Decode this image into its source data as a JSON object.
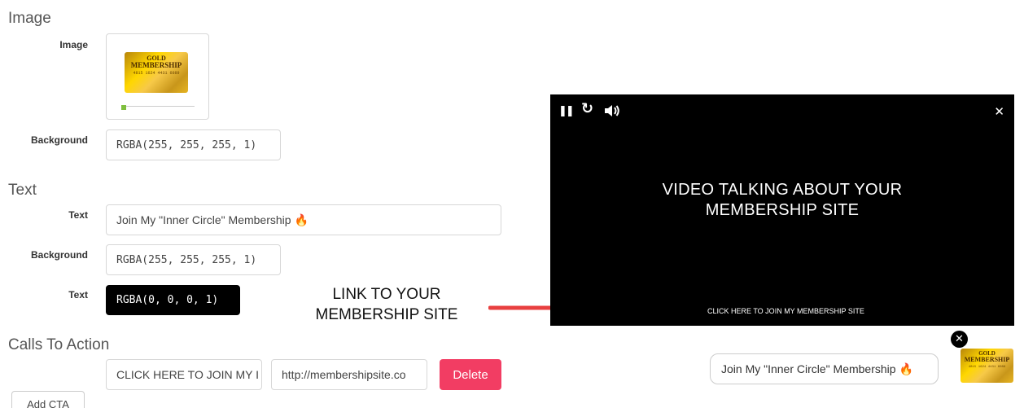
{
  "image_section": {
    "title": "Image",
    "image_label": "Image",
    "background_label": "Background",
    "background_value": "RGBA(255, 255, 255, 1)",
    "card": {
      "line1": "GOLD",
      "line2": "MEMBERSHIP",
      "line3": "4815 1624 4431 6089"
    }
  },
  "text_section": {
    "title": "Text",
    "text_label": "Text",
    "text_value": "Join My \"Inner Circle\" Membership 🔥",
    "background_label": "Background",
    "background_value": "RGBA(255, 255, 255, 1)",
    "color_label": "Text",
    "color_value": "RGBA(0, 0, 0, 1)"
  },
  "cta_section": {
    "title": "Calls To Action",
    "cta_text_value": "CLICK HERE TO JOIN MY I",
    "cta_url_value": "http://membershipsite.co",
    "delete_label": "Delete",
    "add_label": "Add CTA"
  },
  "annotation": {
    "line1": "LINK TO YOUR",
    "line2": "MEMBERSHIP SITE",
    "arrow_color": "#e84040"
  },
  "video": {
    "headline_line1": "VIDEO TALKING ABOUT YOUR",
    "headline_line2": "MEMBERSHIP SITE",
    "cta_link": "CLICK HERE TO JOIN MY MEMBERSHIP SITE",
    "icons": {
      "pause": "pause-icon",
      "replay": "replay-icon",
      "volume": "volume-icon",
      "close": "close-icon"
    },
    "glyphs": {
      "pause": "❚❚",
      "replay": "↻",
      "volume": "🔊",
      "close": "✕"
    }
  },
  "floating_widget": {
    "text": "Join My \"Inner Circle\" Membership 🔥",
    "close_glyph": "✕",
    "card": {
      "line1": "GOLD",
      "line2": "MEMBERSHIP",
      "line3": "4815 1624 4431 6089"
    }
  }
}
